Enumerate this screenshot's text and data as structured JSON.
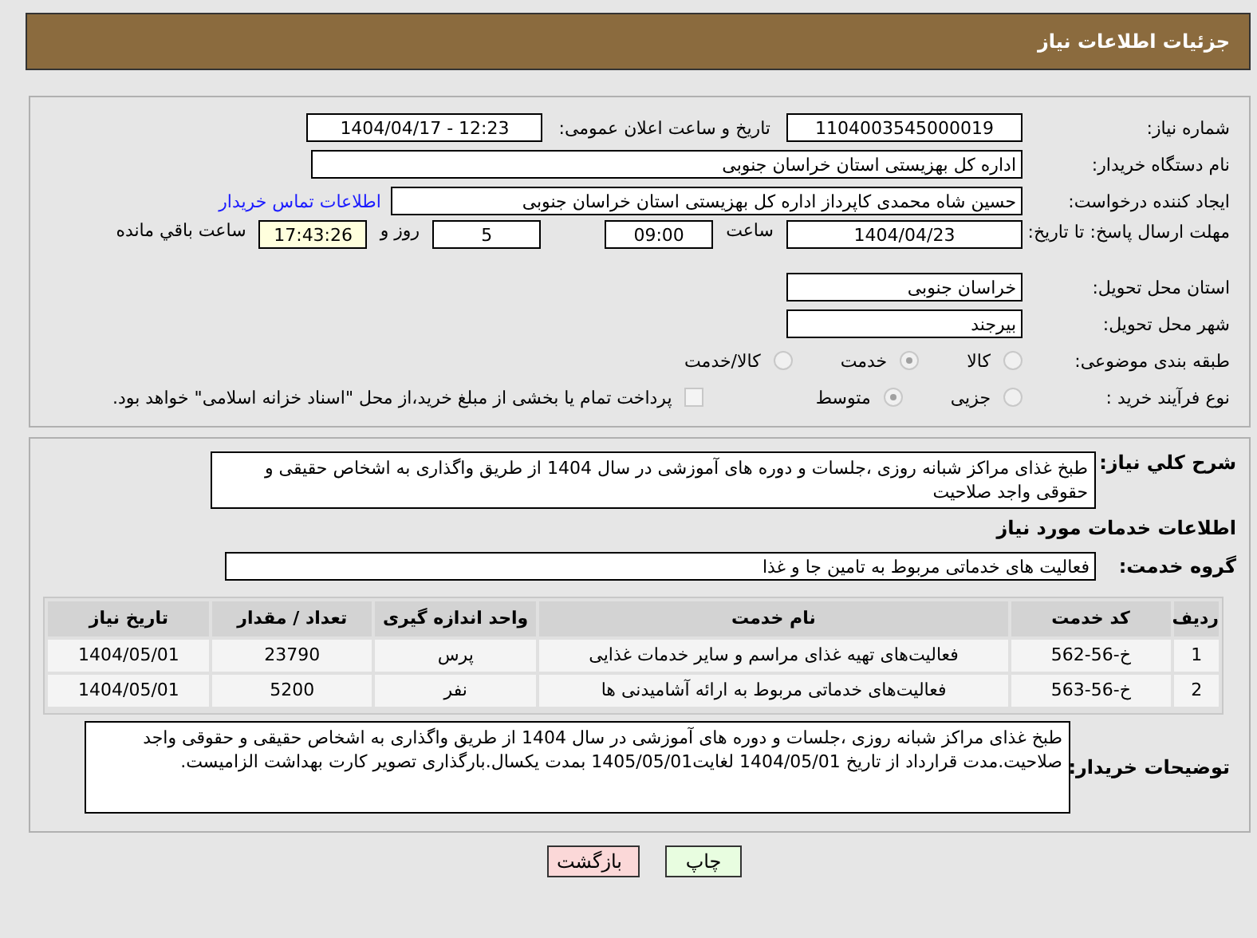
{
  "header": {
    "title": "جزئیات اطلاعات نیاز"
  },
  "info": {
    "need_number": {
      "label": "شماره نیاز:",
      "value": "1104003545000019"
    },
    "announce": {
      "label": "تاریخ و ساعت اعلان عمومی:",
      "value": "1404/04/17 - 12:23"
    },
    "buyer": {
      "label": "نام دستگاه خریدار:",
      "value": "اداره کل بهزیستی استان خراسان جنوبی"
    },
    "creator": {
      "label": "ایجاد کننده درخواست:",
      "value": "حسین شاه محمدی کاپرداز اداره کل بهزیستی استان خراسان جنوبی",
      "link": "اطلاعات تماس خریدار"
    },
    "deadline": {
      "label": "مهلت ارسال پاسخ: تا تاریخ:",
      "date": "1404/04/23",
      "time_label": "ساعت",
      "time": "09:00",
      "days": "5",
      "days_label": "روز و",
      "remaining": "17:43:26",
      "remaining_label": "ساعت باقي مانده"
    },
    "province": {
      "label": "استان محل تحویل:",
      "value": "خراسان جنوبی"
    },
    "city": {
      "label": "شهر محل تحویل:",
      "value": "بیرجند"
    },
    "category": {
      "label": "طبقه بندی موضوعی:",
      "options": [
        {
          "label": "کالا",
          "selected": false
        },
        {
          "label": "خدمت",
          "selected": true
        },
        {
          "label": "کالا/خدمت",
          "selected": false
        }
      ]
    },
    "process": {
      "label": "نوع فرآیند خرید :",
      "options": [
        {
          "label": "جزیی",
          "selected": false
        },
        {
          "label": "متوسط",
          "selected": true
        }
      ],
      "payment": {
        "checked": false,
        "text": "پرداخت تمام یا بخشی از مبلغ خرید،از محل \"اسناد خزانه اسلامی\" خواهد بود."
      }
    }
  },
  "details": {
    "description": {
      "label": "شرح کلي نیاز:",
      "value": "طبخ غذای مراکز شبانه روزی ،جلسات و دوره های آموزشی در سال 1404 از طریق واگذاری به اشخاص حقیقی و حقوقی واجد صلاحیت"
    },
    "services_heading": "اطلاعات خدمات مورد نیاز",
    "group": {
      "label": "گروه خدمت:",
      "value": "فعالیت های خدماتی مربوط به تامین جا و غذا"
    },
    "table": {
      "columns": [
        "ردیف",
        "کد خدمت",
        "نام خدمت",
        "واحد اندازه گیری",
        "تعداد / مقدار",
        "تاریخ نیاز"
      ],
      "rows": [
        [
          "1",
          "خ-56-562",
          "فعالیت‌های تهیه غذای مراسم و سایر خدمات غذایی",
          "پرس",
          "23790",
          "1404/05/01"
        ],
        [
          "2",
          "خ-56-563",
          "فعالیت‌های خدماتی مربوط به ارائه آشامیدنی ها",
          "نفر",
          "5200",
          "1404/05/01"
        ]
      ]
    },
    "buyer_notes": {
      "label": "توضیحات خریدار:",
      "value": "طبخ غذای مراکز شبانه روزی ،جلسات و دوره های آموزشی در سال 1404 از طریق واگذاری به اشخاص حقیقی و حقوقی واجد صلاحیت.مدت قرارداد  از تاریخ 1404/05/01 لغایت1405/05/01 بمدت یکسال.بارگذاری تصویر کارت بهداشت الزامیست."
    }
  },
  "buttons": [
    {
      "label": "چاپ",
      "kind": "print"
    },
    {
      "label": "بازگشت",
      "kind": "back"
    }
  ]
}
